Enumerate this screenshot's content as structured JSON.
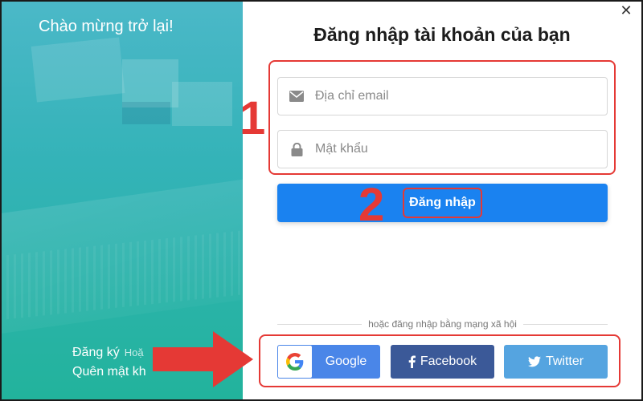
{
  "left_panel": {
    "welcome": "Chào mừng trở lại!",
    "register_label": "Đăng ký",
    "or_label": "Hoặ",
    "forgot_label": "Quên mật kh"
  },
  "form": {
    "title": "Đăng nhập tài khoản của bạn",
    "email_placeholder": "Địa chỉ email",
    "password_placeholder": "Mật khẩu",
    "login_label": "Đăng nhập",
    "divider_label": "hoặc đăng nhập bằng mạng xã hội",
    "close_icon": "close-icon"
  },
  "social": {
    "google_label": "Google",
    "facebook_label": "Facebook",
    "twitter_label": "Twitter"
  },
  "annotations": {
    "step1": "1",
    "step2": "2",
    "color": "#e53935"
  },
  "colors": {
    "primary": "#1a82f0",
    "google": "#4a86e8",
    "facebook": "#3b5998",
    "twitter": "#55a4e0",
    "panel_teal": "#34b3b8"
  }
}
